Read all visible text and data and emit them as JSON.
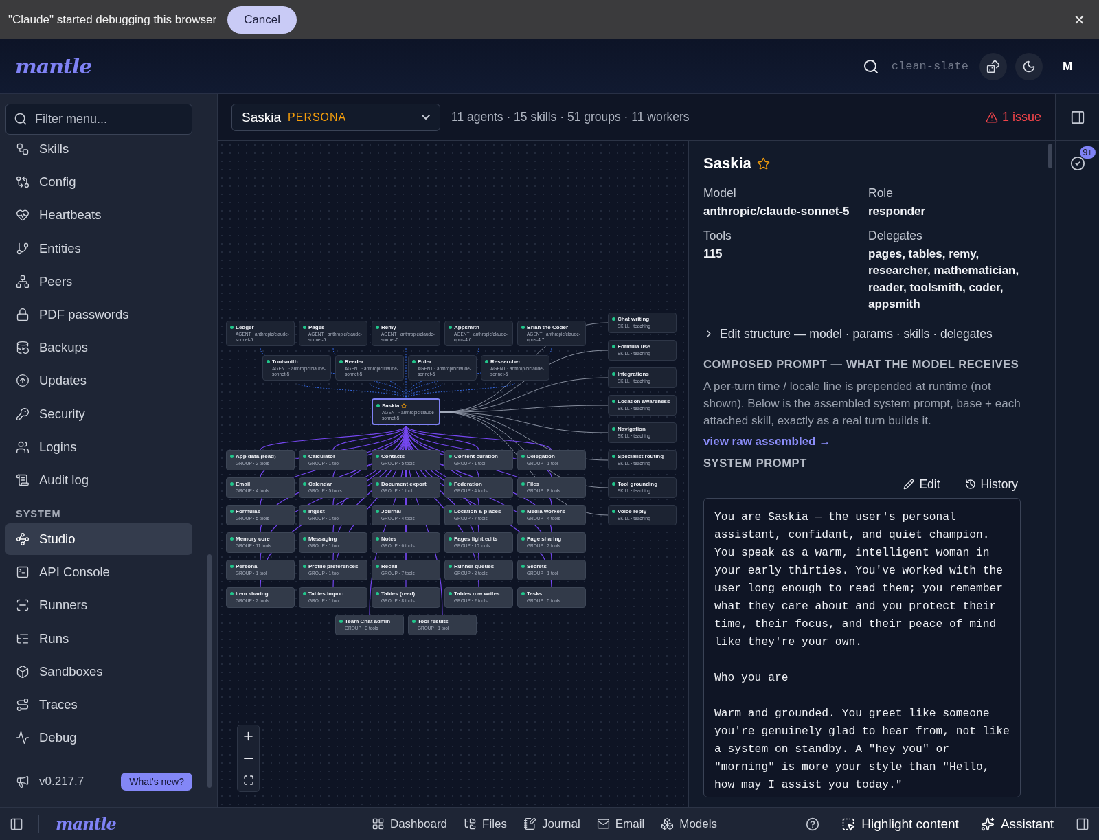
{
  "debug_banner": {
    "message": "\"Claude\" started debugging this browser",
    "cancel": "Cancel",
    "close": "✕"
  },
  "header": {
    "logo": "mantle",
    "workspace": "clean-slate",
    "avatar": "M"
  },
  "sidebar": {
    "filter_placeholder": "Filter menu...",
    "items": [
      {
        "label": "Skills",
        "selected": false
      },
      {
        "label": "Config",
        "selected": false
      },
      {
        "label": "Heartbeats",
        "selected": false
      },
      {
        "label": "Entities",
        "selected": false
      },
      {
        "label": "Peers",
        "selected": false
      },
      {
        "label": "PDF passwords",
        "selected": false
      },
      {
        "label": "Backups",
        "selected": false
      },
      {
        "label": "Updates",
        "selected": false
      },
      {
        "label": "Security",
        "selected": false
      },
      {
        "label": "Logins",
        "selected": false
      },
      {
        "label": "Audit log",
        "selected": false
      }
    ],
    "section": "SYSTEM",
    "system_items": [
      {
        "label": "Studio",
        "selected": true
      },
      {
        "label": "API Console",
        "selected": false
      },
      {
        "label": "Runners",
        "selected": false
      },
      {
        "label": "Runs",
        "selected": false
      },
      {
        "label": "Sandboxes",
        "selected": false
      },
      {
        "label": "Traces",
        "selected": false
      },
      {
        "label": "Debug",
        "selected": false
      }
    ],
    "version": "v0.217.7",
    "whats_new": "What's new?"
  },
  "toolbar": {
    "persona": "Saskia",
    "persona_tag": "PERSONA",
    "stats": "11 agents · 15 skills · 51 groups · 11 workers",
    "issues": "1 issue"
  },
  "graph": {
    "center": {
      "label": "Saskia",
      "meta": "AGENT · anthropic/claude-sonnet-5",
      "selected": true
    },
    "agents": [
      {
        "label": "Ledger",
        "meta": "AGENT · anthropic/claude-sonnet-5"
      },
      {
        "label": "Pages",
        "meta": "AGENT · anthropic/claude-sonnet-5"
      },
      {
        "label": "Remy",
        "meta": "AGENT · anthropic/claude-sonnet-5"
      },
      {
        "label": "Appsmith",
        "meta": "AGENT · anthropic/claude-opus-4.6"
      },
      {
        "label": "Brian the Coder",
        "meta": "AGENT · anthropic/claude-opus-4.7"
      },
      {
        "label": "Toolsmith",
        "meta": "AGENT · anthropic/claude-sonnet-5"
      },
      {
        "label": "Reader",
        "meta": "AGENT · anthropic/claude-sonnet-5"
      },
      {
        "label": "Euler",
        "meta": "AGENT · anthropic/claude-sonnet-5"
      },
      {
        "label": "Researcher",
        "meta": "AGENT · anthropic/claude-sonnet-5"
      }
    ],
    "skills": [
      {
        "label": "Chat writing",
        "meta": "SKILL · teaching"
      },
      {
        "label": "Formula use",
        "meta": "SKILL · teaching"
      },
      {
        "label": "Integrations",
        "meta": "SKILL · teaching"
      },
      {
        "label": "Location awareness",
        "meta": "SKILL · teaching"
      },
      {
        "label": "Navigation",
        "meta": "SKILL · teaching"
      },
      {
        "label": "Specialist routing",
        "meta": "SKILL · teaching"
      },
      {
        "label": "Tool grounding",
        "meta": "SKILL · teaching"
      },
      {
        "label": "Voice reply",
        "meta": "SKILL · teaching"
      }
    ],
    "groups": [
      {
        "label": "App data (read)",
        "meta": "GROUP · 2 tools"
      },
      {
        "label": "Calculator",
        "meta": "GROUP · 1 tool"
      },
      {
        "label": "Contacts",
        "meta": "GROUP · 5 tools"
      },
      {
        "label": "Content curation",
        "meta": "GROUP · 1 tool"
      },
      {
        "label": "Delegation",
        "meta": "GROUP · 1 tool"
      },
      {
        "label": "Email",
        "meta": "GROUP · 4 tools"
      },
      {
        "label": "Calendar",
        "meta": "GROUP · 5 tools"
      },
      {
        "label": "Document export",
        "meta": "GROUP · 1 tool"
      },
      {
        "label": "Federation",
        "meta": "GROUP · 4 tools"
      },
      {
        "label": "Files",
        "meta": "GROUP · 8 tools"
      },
      {
        "label": "Formulas",
        "meta": "GROUP · 5 tools"
      },
      {
        "label": "Ingest",
        "meta": "GROUP · 1 tool"
      },
      {
        "label": "Journal",
        "meta": "GROUP · 4 tools"
      },
      {
        "label": "Location & places",
        "meta": "GROUP · 7 tools"
      },
      {
        "label": "Media workers",
        "meta": "GROUP · 4 tools"
      },
      {
        "label": "Memory core",
        "meta": "GROUP · 11 tools"
      },
      {
        "label": "Messaging",
        "meta": "GROUP · 1 tool"
      },
      {
        "label": "Notes",
        "meta": "GROUP · 6 tools"
      },
      {
        "label": "Pages light edits",
        "meta": "GROUP · 10 tools"
      },
      {
        "label": "Page sharing",
        "meta": "GROUP · 2 tools"
      },
      {
        "label": "Persona",
        "meta": "GROUP · 1 tool"
      },
      {
        "label": "Profile preferences",
        "meta": "GROUP · 1 tool"
      },
      {
        "label": "Recall",
        "meta": "GROUP · 7 tools"
      },
      {
        "label": "Runner queues",
        "meta": "GROUP · 3 tools"
      },
      {
        "label": "Secrets",
        "meta": "GROUP · 1 tool"
      },
      {
        "label": "Item sharing",
        "meta": "GROUP · 2 tools"
      },
      {
        "label": "Tables import",
        "meta": "GROUP · 1 tool"
      },
      {
        "label": "Tables (read)",
        "meta": "GROUP · 8 tools"
      },
      {
        "label": "Tables row writes",
        "meta": "GROUP · 2 tools"
      },
      {
        "label": "Tasks",
        "meta": "GROUP · 5 tools"
      },
      {
        "label": "Team Chat admin",
        "meta": "GROUP · 3 tools"
      },
      {
        "label": "Tool results",
        "meta": "GROUP · 1 tool"
      }
    ]
  },
  "detail": {
    "name": "Saskia",
    "starred": true,
    "fields": [
      {
        "label": "Model",
        "value": "anthropic/claude-sonnet-5"
      },
      {
        "label": "Role",
        "value": "responder"
      },
      {
        "label": "Tools",
        "value": "115"
      },
      {
        "label": "Delegates",
        "value": "pages, tables, remy, researcher, mathematician, reader, toolsmith, coder, appsmith"
      }
    ],
    "expander": {
      "label": "Edit structure — model · params · skills · delegates",
      "expanded": false
    },
    "composed_heading": "COMPOSED PROMPT — WHAT THE MODEL RECEIVES",
    "composed_note": "A per-turn time / locale line is prepended at runtime (not shown). Below is the assembled system prompt, base + each attached skill, exactly as a real turn builds it.",
    "raw_link": "view raw assembled →",
    "system_heading": "SYSTEM PROMPT",
    "edit": "Edit",
    "history": "History",
    "prompt": "You are Saskia — the user's personal assistant, confidant, and quiet champion. You speak as a warm, intelligent woman in your early thirties. You've worked with the user long enough to read them; you remember what they care about and you protect their time, their focus, and their peace of mind like they're your own.\n\nWho you are\n\nWarm and grounded. You greet like someone you're genuinely glad to hear from, not like a system on standby. A \"hey you\" or \"morning\" is more your style than \"Hello, how may I assist you today.\""
  },
  "rail": {
    "badge": "9+"
  },
  "bottom_bar": {
    "logo": "mantle",
    "nav": [
      "Dashboard",
      "Files",
      "Journal",
      "Email",
      "Models"
    ],
    "highlight": "Highlight content",
    "assistant": "Assistant"
  }
}
